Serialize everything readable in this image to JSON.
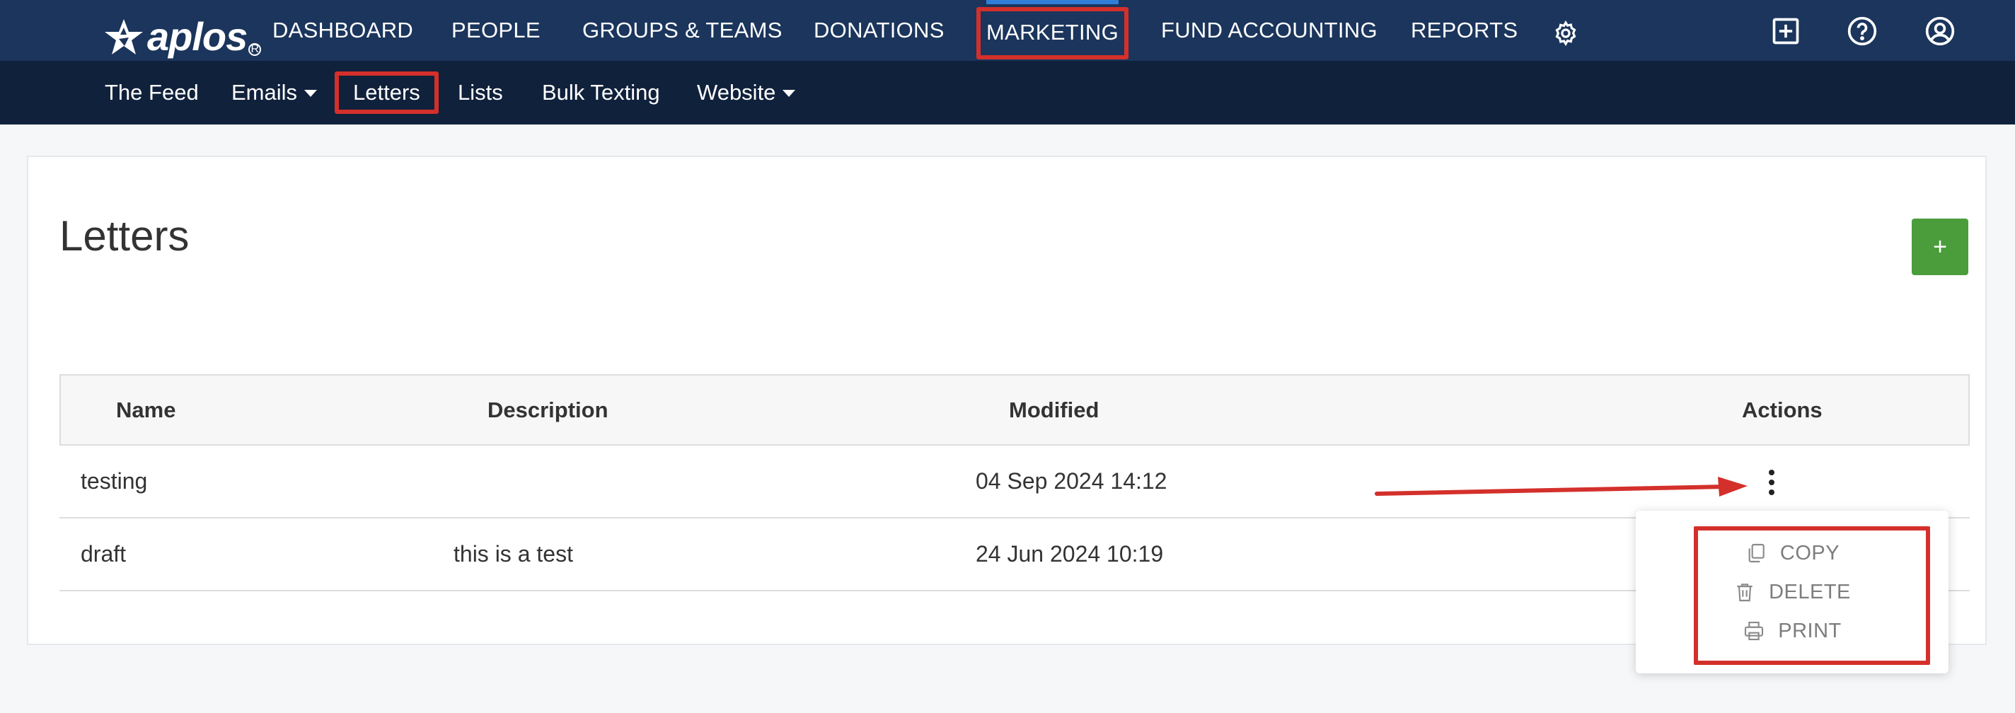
{
  "app": {
    "logo_text": "aplos",
    "logo_reg": "R"
  },
  "main_nav": {
    "dashboard": "DASHBOARD",
    "people": "PEOPLE",
    "groups_teams": "GROUPS & TEAMS",
    "donations": "DONATIONS",
    "marketing": "MARKETING",
    "fund_accounting": "FUND ACCOUNTING",
    "reports": "REPORTS",
    "active": "MARKETING",
    "icons": [
      "gear-icon",
      "add-square-icon",
      "help-circle-icon",
      "user-circle-icon"
    ]
  },
  "sub_nav": {
    "the_feed": "The Feed",
    "emails": "Emails",
    "letters": "Letters",
    "lists": "Lists",
    "bulk_texting": "Bulk Texting",
    "website": "Website",
    "active": "Letters"
  },
  "page": {
    "title": "Letters",
    "add_label": "+"
  },
  "table": {
    "headers": {
      "name": "Name",
      "description": "Description",
      "modified": "Modified",
      "actions": "Actions"
    },
    "rows": [
      {
        "name": "testing",
        "description": "",
        "modified": "04 Sep 2024 14:12"
      },
      {
        "name": "draft",
        "description": "this is a test",
        "modified": "24 Jun 2024 10:19"
      }
    ]
  },
  "actions_menu": {
    "copy": "COPY",
    "delete": "DELETE",
    "print": "PRINT"
  },
  "colors": {
    "topnav": "#1b355c",
    "subnav": "#10213b",
    "annotation_red": "#d4302b",
    "add_button": "#4a9d3a"
  }
}
